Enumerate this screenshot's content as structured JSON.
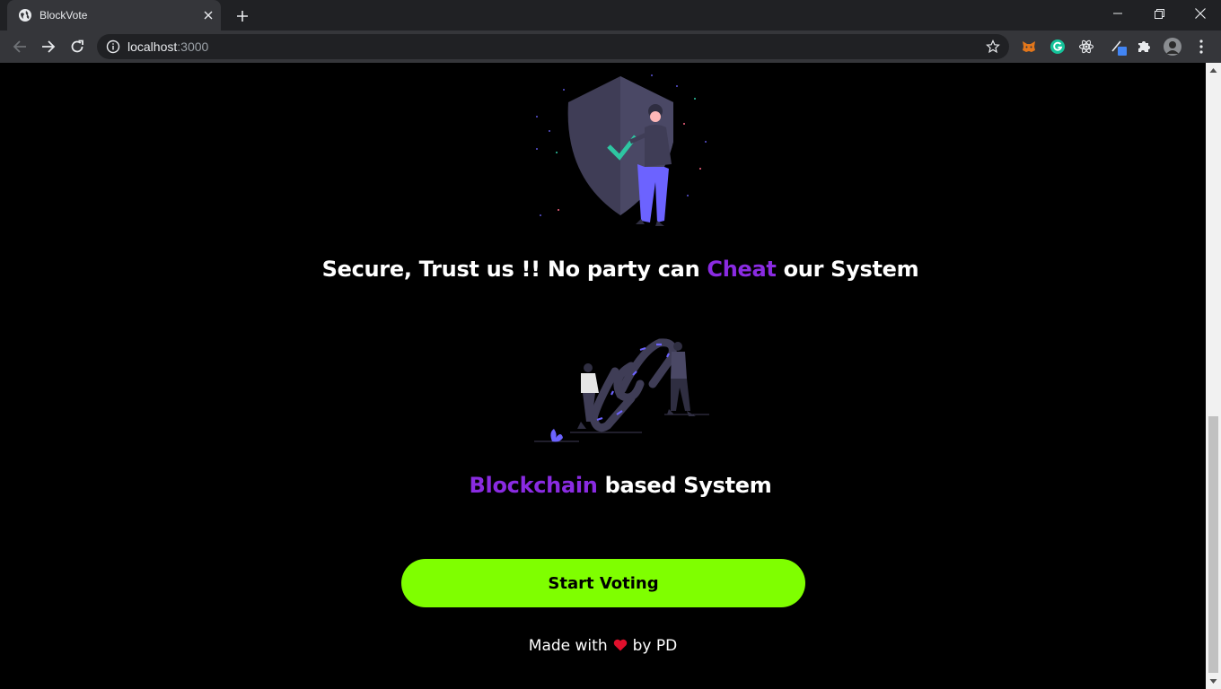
{
  "browser": {
    "tab_title": "BlockVote",
    "url_host": "localhost",
    "url_port": ":3000",
    "extensions": [
      "metamask-icon",
      "grammarly-icon",
      "react-devtools-icon",
      "color-picker-icon",
      "extensions-puzzle-icon",
      "profile-avatar"
    ]
  },
  "page": {
    "headline1": {
      "before": "Secure, Trust us !! No party can ",
      "accent": "Cheat",
      "after": " our System"
    },
    "headline2": {
      "accent": "Blockchain",
      "after": " based System"
    },
    "cta_label": "Start Voting",
    "footer": {
      "before": "Made with",
      "after": "by PD"
    }
  },
  "colors": {
    "accent": "#8a2be2",
    "cta_background": "#7fff00",
    "page_background": "#000000",
    "heart": "#e0102c"
  }
}
